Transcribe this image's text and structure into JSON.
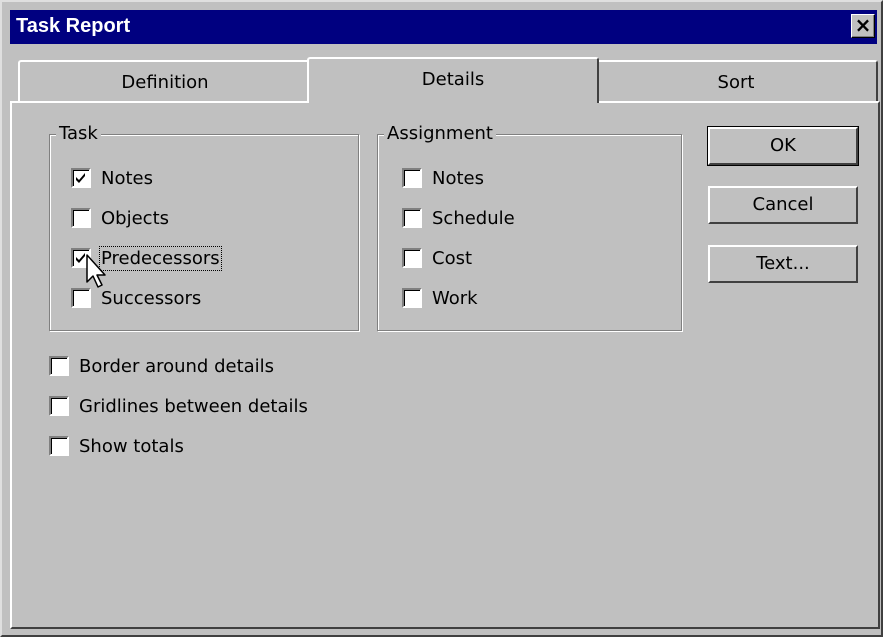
{
  "window": {
    "title": "Task Report",
    "close_symbol": "×"
  },
  "tabs": [
    {
      "label": "Definition",
      "active": false
    },
    {
      "label": "Details",
      "active": true
    },
    {
      "label": "Sort",
      "active": false
    }
  ],
  "task_group": {
    "label": "Task",
    "items": [
      {
        "label": "Notes",
        "checked": true
      },
      {
        "label": "Objects",
        "checked": false
      },
      {
        "label": "Predecessors",
        "checked": true
      },
      {
        "label": "Successors",
        "checked": false
      }
    ]
  },
  "assignment_group": {
    "label": "Assignment",
    "items": [
      {
        "label": "Notes",
        "checked": false
      },
      {
        "label": "Schedule",
        "checked": false
      },
      {
        "label": "Cost",
        "checked": false
      },
      {
        "label": "Work",
        "checked": false
      }
    ]
  },
  "options": [
    {
      "label": "Border around details",
      "checked": false
    },
    {
      "label": "Gridlines between details",
      "checked": false
    },
    {
      "label": "Show totals",
      "checked": false
    }
  ],
  "buttons": {
    "ok": "OK",
    "cancel": "Cancel",
    "text": "Text..."
  }
}
